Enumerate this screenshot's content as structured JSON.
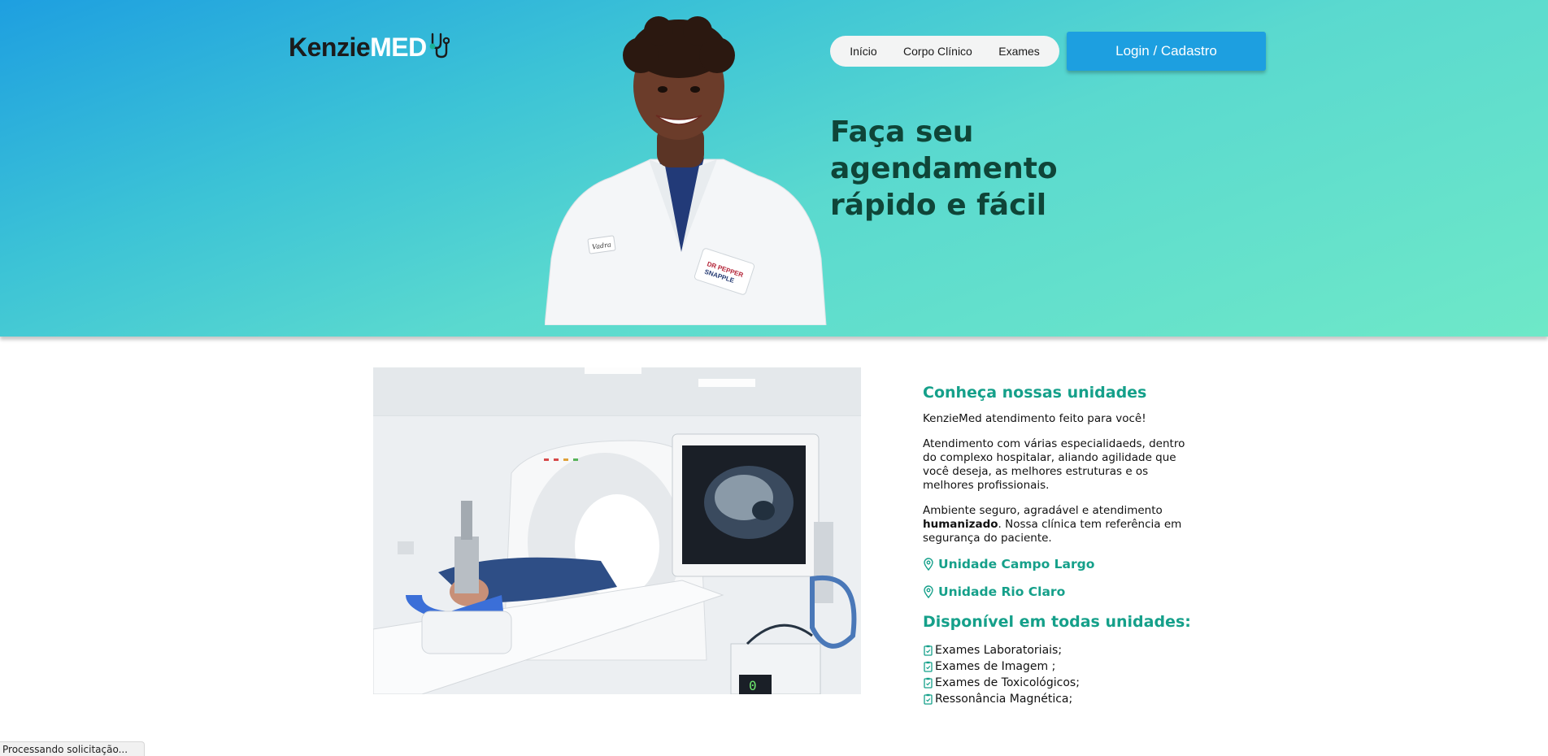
{
  "header": {
    "logo": {
      "part1": "Kenzie",
      "part2": "MED",
      "icon": "stethoscope-icon"
    },
    "nav": [
      {
        "label": "Início"
      },
      {
        "label": "Corpo Clínico"
      },
      {
        "label": "Exames"
      }
    ],
    "login_label": "Login / Cadastro",
    "headline": [
      "Faça seu",
      "agendamento",
      "rápido e fácil"
    ],
    "image": {
      "subject": "doctor-photo",
      "badge_line1": "DR PEPPER",
      "badge_line2": "SNAPPLE",
      "tag": "Vadra"
    }
  },
  "main": {
    "image": "ct-scanner-photo",
    "monitor_value": "0",
    "title": "Conheça nossas unidades",
    "intro": "KenzieMed atendimento feito para você!",
    "description": "Atendimento com várias especialidaeds, dentro do complexo hospitalar, aliando agilidade que você deseja, as melhores estruturas e os melhores profissionais.",
    "environment_prefix": "Ambiente seguro, agradável e atendimento ",
    "environment_bold": "humanizado",
    "environment_suffix": ". Nossa clínica tem referência em segurança do paciente.",
    "units": [
      {
        "label": "Unidade Campo Largo",
        "icon": "location-pin-icon"
      },
      {
        "label": "Unidade Rio Claro",
        "icon": "location-pin-icon"
      }
    ],
    "services_title": "Disponível em todas unidades:",
    "services": [
      {
        "label": "Exames Laboratoriais;",
        "icon": "clipboard-icon"
      },
      {
        "label": "Exames de Imagem ;",
        "icon": "clipboard-icon"
      },
      {
        "label": "Exames de Toxicológicos;",
        "icon": "clipboard-icon"
      },
      {
        "label": "Ressonância Magnética;",
        "icon": "clipboard-icon"
      }
    ]
  },
  "status": {
    "text": "Processando solicitação..."
  },
  "colors": {
    "accent": "#15a08a",
    "button": "#1d9fe0",
    "headline": "#0f4538",
    "gradient_start": "#1e9fe0",
    "gradient_end": "#6ee8c8"
  }
}
